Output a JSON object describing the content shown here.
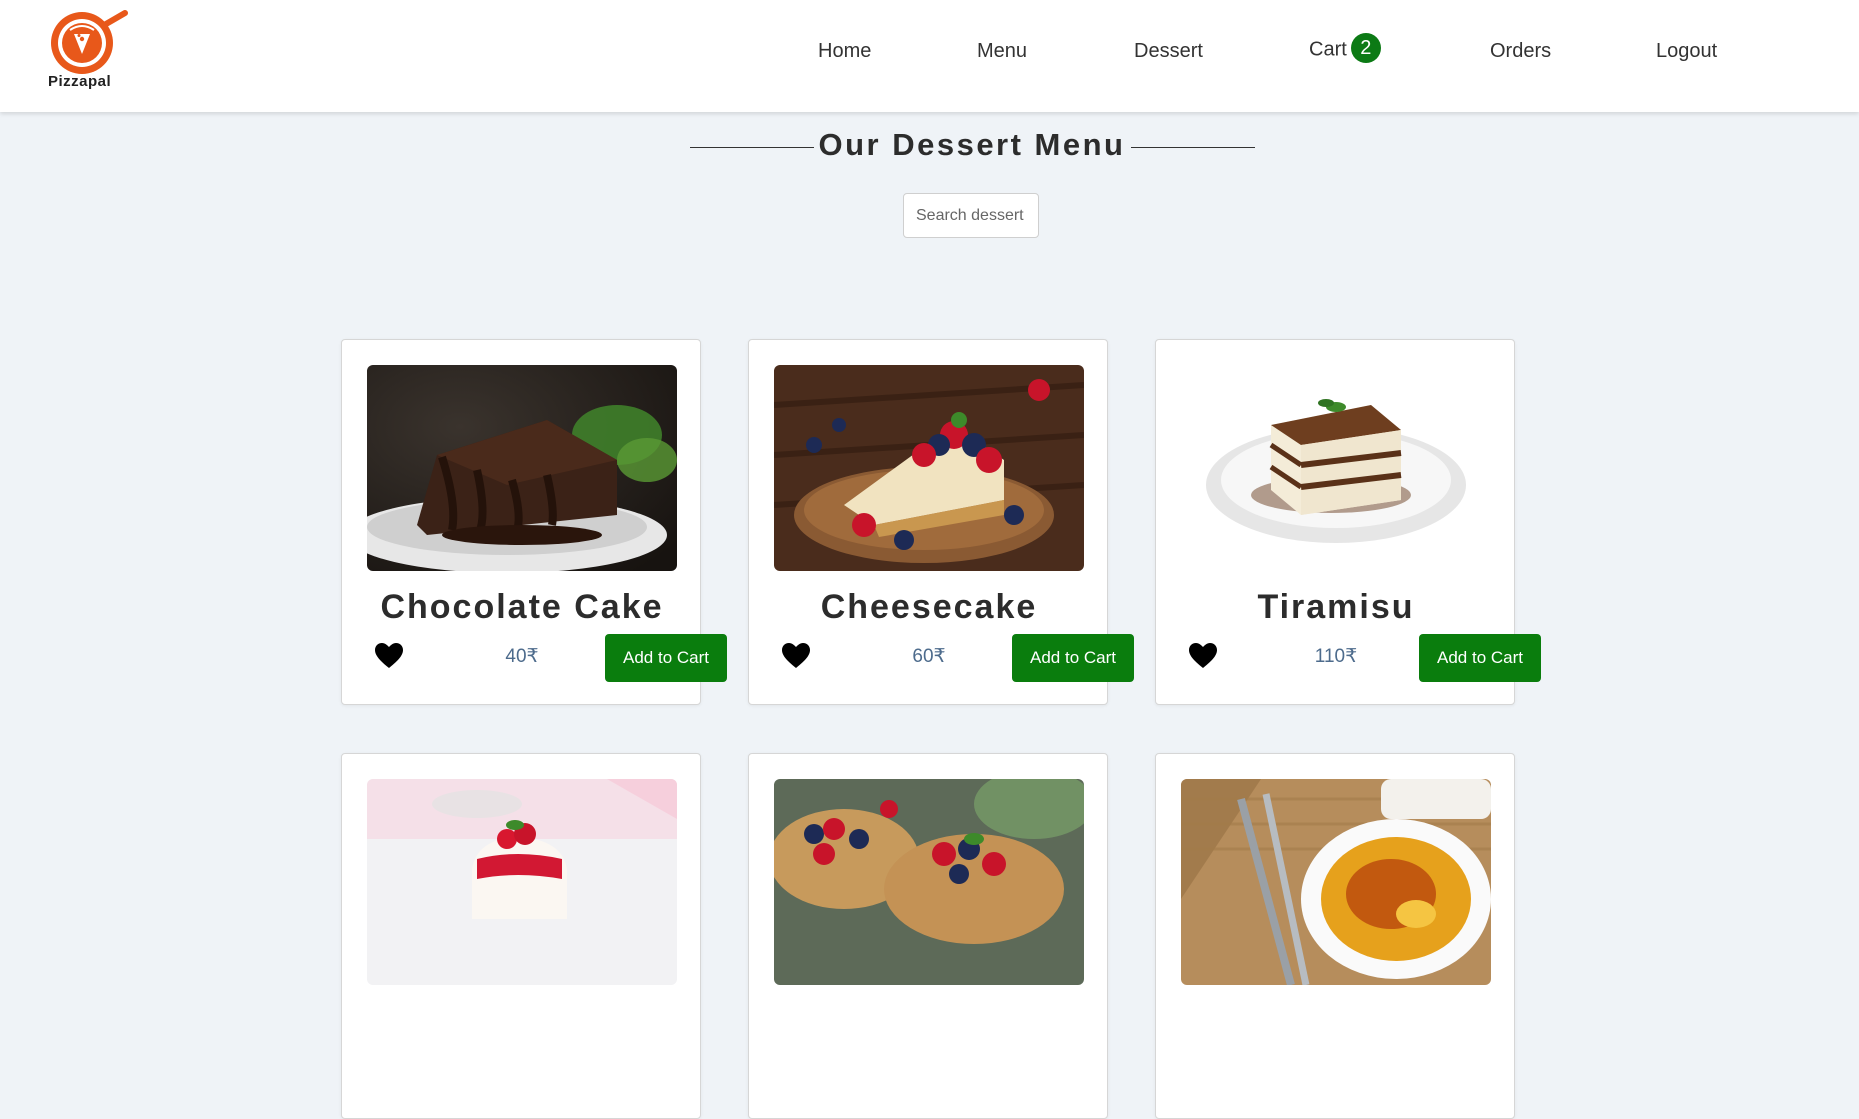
{
  "brand": {
    "name": "Pizzapal",
    "color": "#e8581a"
  },
  "nav": {
    "items": [
      "Home",
      "Menu",
      "Dessert",
      "Cart",
      "Orders",
      "Logout"
    ],
    "cart_count": "2"
  },
  "page": {
    "title": "Our Dessert Menu",
    "search_placeholder": "Search dessert"
  },
  "colors": {
    "accent_green": "#0a7d0d",
    "price_blue": "#4d6b8c",
    "background": "#eff3f7"
  },
  "desserts": [
    {
      "name": "Chocolate Cake",
      "price": "40₹",
      "button": "Add to Cart",
      "image": "chocolate-cake-photo"
    },
    {
      "name": "Cheesecake",
      "price": "60₹",
      "button": "Add to Cart",
      "image": "cheesecake-photo"
    },
    {
      "name": "Tiramisu",
      "price": "110₹",
      "button": "Add to Cart",
      "image": "tiramisu-photo"
    },
    {
      "image": "panna-cotta-photo"
    },
    {
      "image": "fruit-tart-photo"
    },
    {
      "image": "creme-brulee-photo"
    }
  ]
}
